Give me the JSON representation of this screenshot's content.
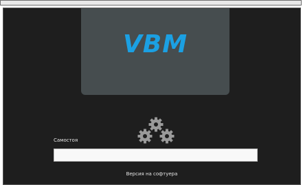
{
  "app": {
    "logo_text": "VBM"
  },
  "status": {
    "label": "Самостоя",
    "progress": 1.0
  },
  "footer": {
    "version_label": "Версия на софтуера"
  },
  "icons": {
    "loading": "gears-icon"
  },
  "colors": {
    "background": "#1e1e1e",
    "logo_panel": "#464d4f",
    "logo_text": "#1ba0e3",
    "progress_bar": "#e6e6e6"
  }
}
